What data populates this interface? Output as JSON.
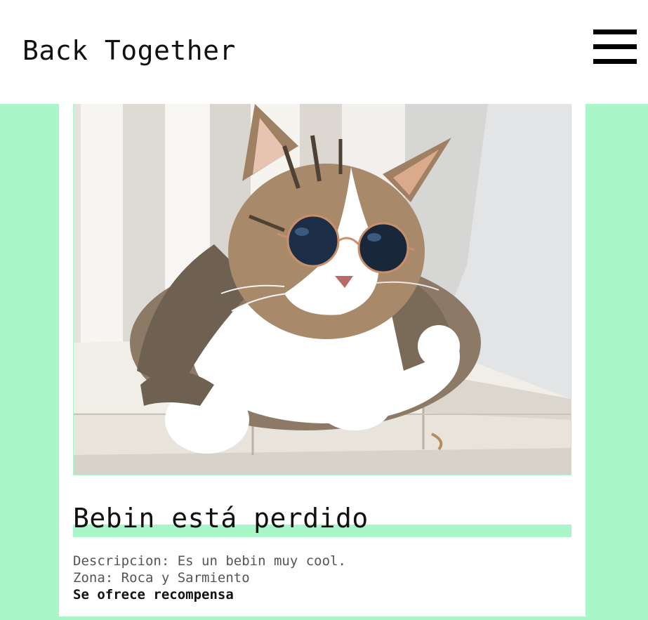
{
  "header": {
    "logo": "Back Together",
    "menu_icon": "hamburger-menu-icon"
  },
  "post": {
    "image_alt": "Gato con gafas de sol",
    "title": "Bebin está perdido",
    "description": "Descripcion: Es un bebin muy cool.",
    "zone": "Zona: Roca y Sarmiento",
    "reward": "Se ofrece recompensa"
  },
  "colors": {
    "accent": "#a9f7c9",
    "card": "#ffffff",
    "text": "#111111",
    "muted": "#555555"
  }
}
